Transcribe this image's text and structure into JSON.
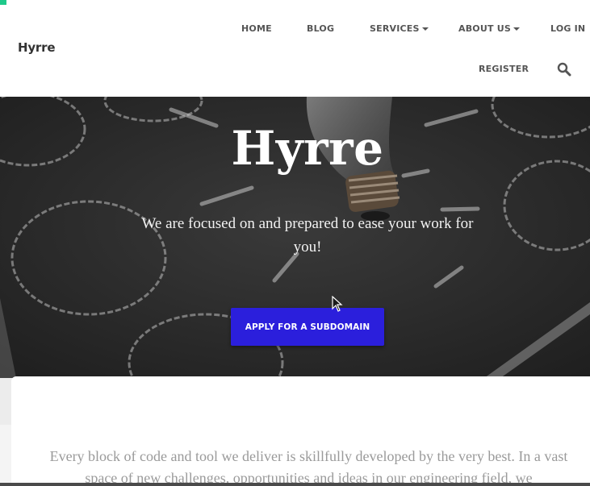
{
  "brand": {
    "name": "Hyrre"
  },
  "nav": {
    "home": "HOME",
    "blog": "BLOG",
    "services": "SERVICES",
    "about": "ABOUT US",
    "login": "LOG IN",
    "register": "REGISTER"
  },
  "hero": {
    "title": "Hyrre",
    "subtitle": "We are focused on and prepared to ease your work for you!",
    "cta_label": "APPLY FOR A SUBDOMAIN"
  },
  "content": {
    "paragraph": "Every block of code and tool we deliver is skillfully developed by the very best. In a vast space of new challenges, opportunities and ideas in our engineering field, we"
  },
  "colors": {
    "accent": "#2b1fdc",
    "header_bg": "#ffffff",
    "hero_bg": "#2a2a2a",
    "corner_mark": "#1ec98a"
  },
  "icons": {
    "search": "search-icon",
    "dropdown": "caret-down-icon"
  }
}
